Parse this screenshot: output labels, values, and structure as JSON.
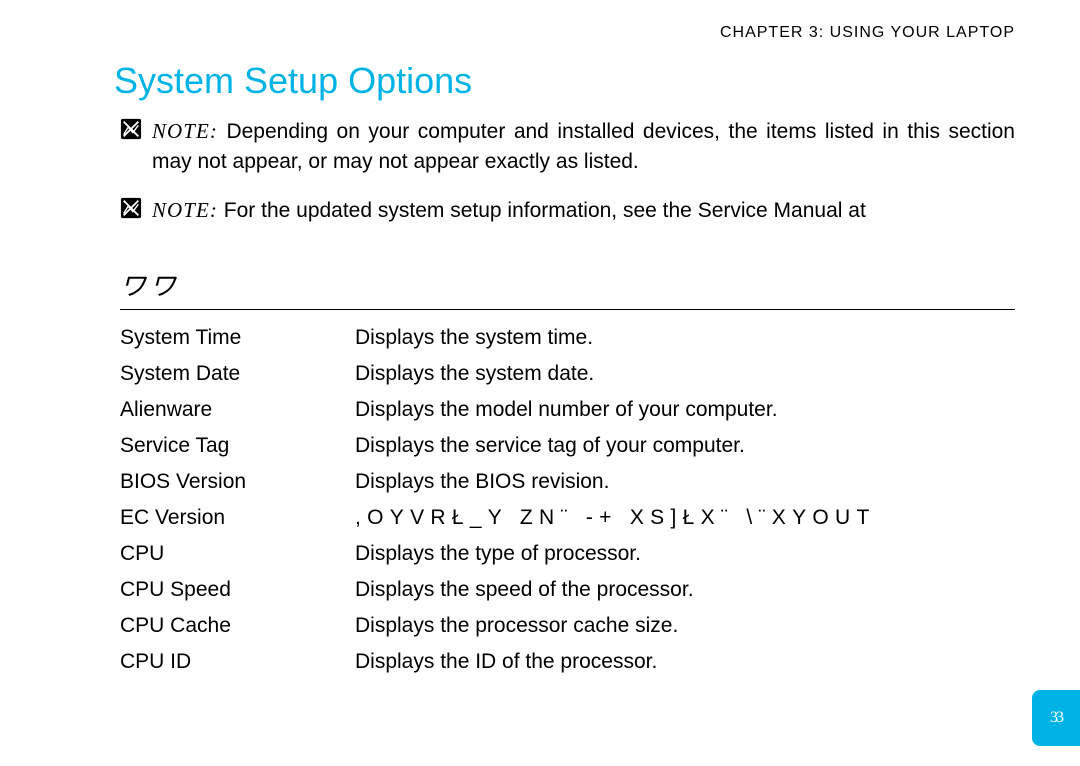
{
  "header": {
    "chapter": "CHAPTER 3: USING YOUR LAPTOP"
  },
  "title": "System Setup Options",
  "notes": {
    "note1_label": "NOTE:",
    "note1_text": " Depending on your computer and installed devices, the items listed in this section may not appear, or may not appear exactly as listed.",
    "note2_label": "NOTE:",
    "note2_text": " For the updated system setup information, see the Service Manual at"
  },
  "section_label": "ワワ",
  "table_rows": [
    {
      "label": "System Time",
      "desc": "Displays the system time."
    },
    {
      "label": "System Date",
      "desc": "Displays the system date."
    },
    {
      "label": "Alienware",
      "desc": "Displays the model number of your computer."
    },
    {
      "label": "Service Tag",
      "desc": "Displays the service tag of your computer."
    },
    {
      "label": "BIOS Version",
      "desc": "Displays the BIOS revision."
    },
    {
      "label": "EC Version",
      "desc": ",OYVRŁ_Y ZN¨ -+  XS]ŁX¨ \\¨XYOUT"
    },
    {
      "label": "CPU",
      "desc": "Displays the type of processor."
    },
    {
      "label": "CPU Speed",
      "desc": "Displays the speed of the processor."
    },
    {
      "label": "CPU Cache",
      "desc": "Displays the processor cache size."
    },
    {
      "label": "CPU ID",
      "desc": "Displays the ID of the processor."
    }
  ],
  "page_badge": "33"
}
